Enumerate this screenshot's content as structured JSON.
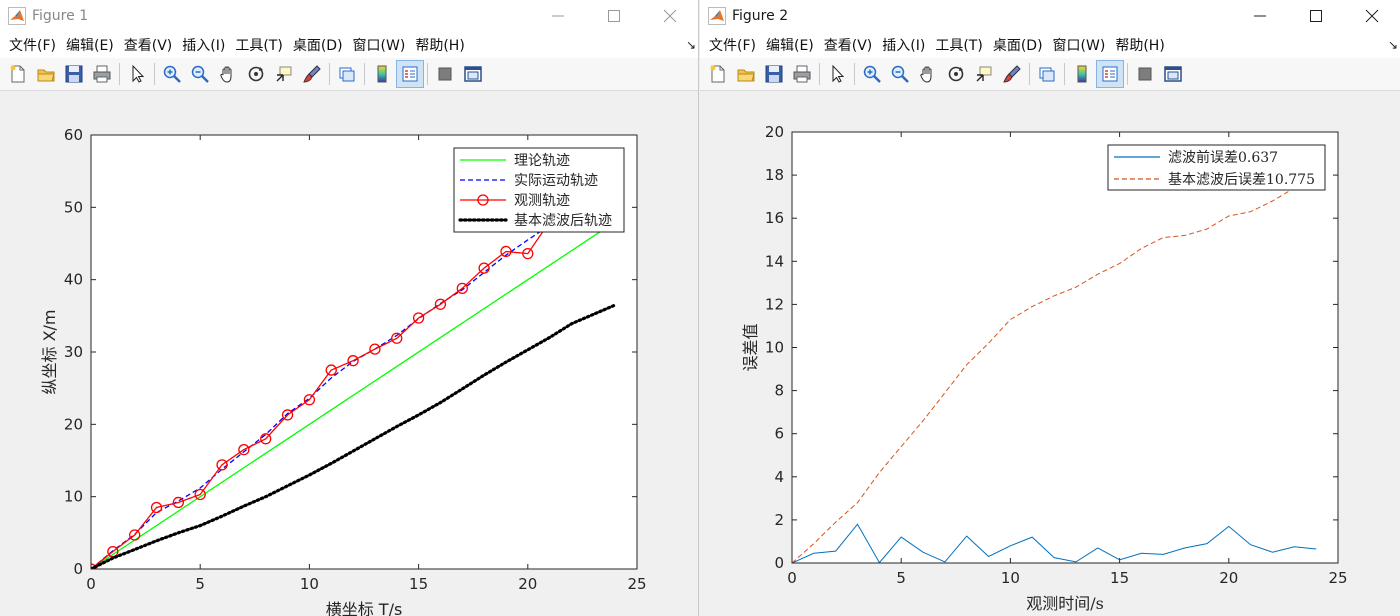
{
  "windows": [
    {
      "id": "fig1",
      "title": "Figure 1",
      "menu": [
        "文件(F)",
        "编辑(E)",
        "查看(V)",
        "插入(I)",
        "工具(T)",
        "桌面(D)",
        "窗口(W)",
        "帮助(H)"
      ],
      "overflow_arrow": "↘",
      "toolbar": [
        "new-figure-icon",
        "open-file-icon",
        "save-icon",
        "print-icon",
        "|",
        "pointer-icon",
        "|",
        "zoom-in-icon",
        "zoom-out-icon",
        "pan-icon",
        "rotate-3d-icon",
        "data-cursor-icon",
        "brush-icon",
        "|",
        "link-plot-icon",
        "|",
        "colorbar-icon",
        "legend-icon",
        "|",
        "hide-plot-tools-icon",
        "show-plot-tools-icon"
      ]
    },
    {
      "id": "fig2",
      "title": "Figure 2",
      "menu": [
        "文件(F)",
        "编辑(E)",
        "查看(V)",
        "插入(I)",
        "工具(T)",
        "桌面(D)",
        "窗口(W)",
        "帮助(H)"
      ],
      "overflow_arrow": "↘",
      "toolbar": [
        "new-figure-icon",
        "open-file-icon",
        "save-icon",
        "print-icon",
        "|",
        "pointer-icon",
        "|",
        "zoom-in-icon",
        "zoom-out-icon",
        "pan-icon",
        "rotate-3d-icon",
        "data-cursor-icon",
        "brush-icon",
        "|",
        "link-plot-icon",
        "|",
        "colorbar-icon",
        "legend-icon",
        "|",
        "hide-plot-tools-icon",
        "show-plot-tools-icon"
      ]
    }
  ],
  "chart_data": [
    {
      "type": "line",
      "title": "",
      "xlabel": "横坐标 T/s",
      "ylabel": "纵坐标 X/m",
      "xlim": [
        0,
        25
      ],
      "ylim": [
        0,
        60
      ],
      "xticks": [
        0,
        5,
        10,
        15,
        20,
        25
      ],
      "yticks": [
        0,
        10,
        20,
        30,
        40,
        50,
        60
      ],
      "legend_position": "top-right",
      "series": [
        {
          "name": "理论轨迹",
          "color": "#00ff00",
          "style": "solid",
          "marker": "none",
          "x": [
            0,
            24
          ],
          "y": [
            0,
            48
          ]
        },
        {
          "name": "实际运动轨迹",
          "color": "#0000ff",
          "style": "dashed",
          "marker": "none",
          "x": [
            0,
            1,
            2,
            3,
            4,
            5,
            6,
            7,
            8,
            9,
            10,
            11,
            12,
            13,
            14,
            15,
            16,
            17,
            18,
            19,
            20,
            21,
            22,
            23,
            24
          ],
          "y": [
            0,
            2.5,
            4.8,
            7.8,
            9.4,
            11.2,
            13.8,
            16.2,
            18.6,
            21.5,
            23.6,
            26.4,
            28.7,
            30.4,
            32.3,
            34.6,
            36.7,
            38.6,
            41.0,
            43.4,
            45.5,
            47.5,
            50.0,
            52.5,
            55.0
          ]
        },
        {
          "name": "观测轨迹",
          "color": "#ff0000",
          "style": "solid",
          "marker": "circle",
          "x": [
            0,
            1,
            2,
            3,
            4,
            5,
            6,
            7,
            8,
            9,
            10,
            11,
            12,
            13,
            14,
            15,
            16,
            17,
            18,
            19,
            20,
            21,
            22,
            23,
            24
          ],
          "y": [
            0,
            2.4,
            4.7,
            8.5,
            9.2,
            10.3,
            14.4,
            16.5,
            18.0,
            21.3,
            23.4,
            27.5,
            28.8,
            30.4,
            31.9,
            34.7,
            36.6,
            38.8,
            41.6,
            43.9,
            43.6,
            48.0,
            50.5,
            52.5,
            55.0
          ]
        },
        {
          "name": "基本滤波后轨迹",
          "color": "#000000",
          "style": "dotted",
          "marker": "none",
          "x": [
            0,
            1,
            2,
            3,
            4,
            5,
            6,
            7,
            8,
            9,
            10,
            11,
            12,
            13,
            14,
            15,
            16,
            17,
            18,
            19,
            20,
            21,
            22,
            23,
            24
          ],
          "y": [
            0,
            1.5,
            2.7,
            3.9,
            5.0,
            6.0,
            7.3,
            8.7,
            10.0,
            11.5,
            13.0,
            14.6,
            16.3,
            18.0,
            19.7,
            21.3,
            23.0,
            24.9,
            26.8,
            28.6,
            30.3,
            32.0,
            33.9,
            35.2,
            36.5
          ]
        }
      ]
    },
    {
      "type": "line",
      "title": "",
      "xlabel": "观测时间/s",
      "ylabel": "误差值",
      "xlim": [
        0,
        25
      ],
      "ylim": [
        0,
        20
      ],
      "xticks": [
        0,
        5,
        10,
        15,
        20,
        25
      ],
      "yticks": [
        0,
        2,
        4,
        6,
        8,
        10,
        12,
        14,
        16,
        18,
        20
      ],
      "legend_position": "top-right",
      "series": [
        {
          "name": "滤波前误差0.637",
          "color": "#0072bd",
          "style": "solid",
          "x": [
            0,
            1,
            2,
            3,
            4,
            5,
            6,
            7,
            8,
            9,
            10,
            11,
            12,
            13,
            14,
            15,
            16,
            17,
            18,
            19,
            20,
            21,
            22,
            23,
            24
          ],
          "y": [
            0,
            0.45,
            0.55,
            1.8,
            0.02,
            1.2,
            0.5,
            0.05,
            1.25,
            0.3,
            0.8,
            1.2,
            0.25,
            0.05,
            0.7,
            0.15,
            0.45,
            0.4,
            0.7,
            0.9,
            1.7,
            0.85,
            0.5,
            0.75,
            0.65
          ]
        },
        {
          "name": "基本滤波后误差10.775",
          "color": "#d95319",
          "style": "dashed",
          "x": [
            0,
            1,
            2,
            3,
            4,
            5,
            6,
            7,
            8,
            9,
            10,
            11,
            12,
            13,
            14,
            15,
            16,
            17,
            18,
            19,
            20,
            21,
            22,
            23,
            24
          ],
          "y": [
            0,
            0.9,
            1.9,
            2.8,
            4.2,
            5.4,
            6.6,
            7.9,
            9.2,
            10.2,
            11.3,
            11.9,
            12.4,
            12.8,
            13.4,
            13.9,
            14.6,
            15.1,
            15.2,
            15.5,
            16.1,
            16.3,
            16.8,
            17.4,
            17.9
          ]
        }
      ]
    }
  ]
}
